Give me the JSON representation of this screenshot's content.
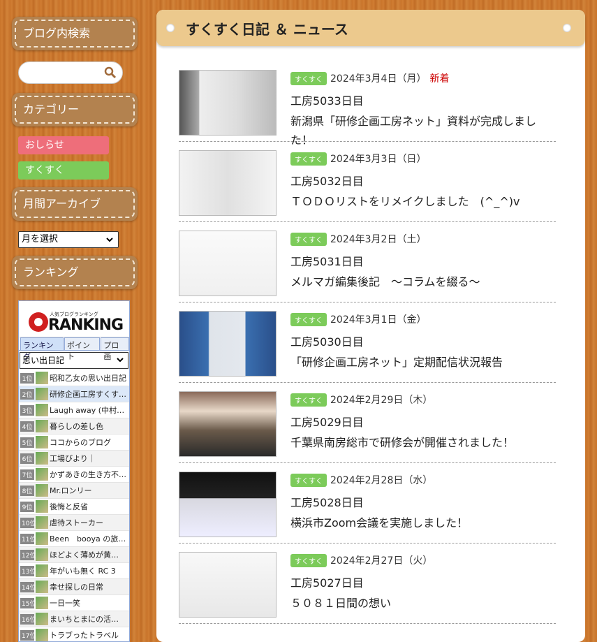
{
  "sidebar": {
    "search_title": "ブログ内検索",
    "category_title": "カテゴリー",
    "categories": [
      {
        "label": "おしらせ",
        "color": "#ee6e7a"
      },
      {
        "label": "すくすく",
        "color": "#7ccb5a"
      }
    ],
    "archive_title": "月間アーカイブ",
    "archive_select": "月を選択",
    "ranking_title": "ランキング",
    "ranking": {
      "logo_small": "人気ブログランキング",
      "logo": "RANKING",
      "tabs": [
        "ランキング",
        "ポイント",
        "プロ画"
      ],
      "genre": "思い出日記",
      "rows": [
        {
          "rank": "1位",
          "name": "昭和乙女の思い出日記"
        },
        {
          "rank": "2位",
          "name": "研修企画工房すくす…"
        },
        {
          "rank": "3位",
          "name": "Laugh away (中村…"
        },
        {
          "rank": "4位",
          "name": "暮らしの差し色"
        },
        {
          "rank": "5位",
          "name": "ココからのブログ"
        },
        {
          "rank": "6位",
          "name": "工場びより｜"
        },
        {
          "rank": "7位",
          "name": "かずあきの生き方不…"
        },
        {
          "rank": "8位",
          "name": "Mr.ロンリー"
        },
        {
          "rank": "9位",
          "name": "後悔と反省"
        },
        {
          "rank": "10位",
          "name": "虐待ストーカー"
        },
        {
          "rank": "11位",
          "name": "Been　booya の旅…"
        },
        {
          "rank": "12位",
          "name": "ほどよく薄めが黄…"
        },
        {
          "rank": "13位",
          "name": "年がいも無く RC 3"
        },
        {
          "rank": "14位",
          "name": "幸せ探しの日常"
        },
        {
          "rank": "15位",
          "name": "一日一笑"
        },
        {
          "rank": "16位",
          "name": "まいちとまにの活…"
        },
        {
          "rank": "17位",
          "name": "トラブったトラベル"
        }
      ]
    }
  },
  "main": {
    "title": "すくすく日記 ＆ ニュース",
    "posts": [
      {
        "tag": "すくすく",
        "date": "2024年3月4日（月）",
        "new": "新着",
        "title": "工房5033日目",
        "excerpt": "新潟県「研修企画工房ネット」資料が完成しました！"
      },
      {
        "tag": "すくすく",
        "date": "2024年3月3日（日）",
        "new": "",
        "title": "工房5032日目",
        "excerpt": "ＴＯＤＯリストをリメイクしました　(^_^)v"
      },
      {
        "tag": "すくすく",
        "date": "2024年3月2日（土）",
        "new": "",
        "title": "工房5031日目",
        "excerpt": "メルマガ編集後記　～コラムを綴る～"
      },
      {
        "tag": "すくすく",
        "date": "2024年3月1日（金）",
        "new": "",
        "title": "工房5030日目",
        "excerpt": "「研修企画工房ネット」定期配信状況報告"
      },
      {
        "tag": "すくすく",
        "date": "2024年2月29日（木）",
        "new": "",
        "title": "工房5029日目",
        "excerpt": "千葉県南房総市で研修会が開催されました！"
      },
      {
        "tag": "すくすく",
        "date": "2024年2月28日（水）",
        "new": "",
        "title": "工房5028日目",
        "excerpt": "横浜市Zoom会議を実施しました！"
      },
      {
        "tag": "すくすく",
        "date": "2024年2月27日（火）",
        "new": "",
        "title": "工房5027日目",
        "excerpt": "５０８１日間の想い"
      }
    ]
  }
}
